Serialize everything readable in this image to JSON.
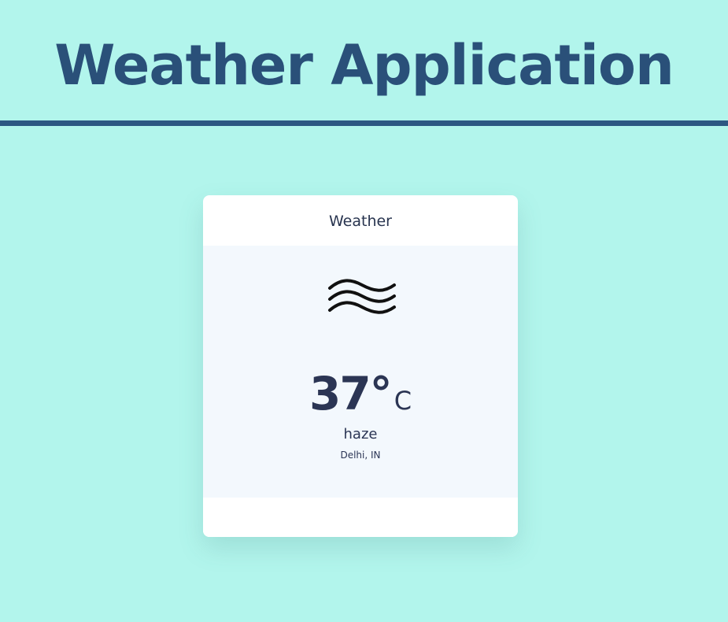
{
  "app": {
    "title": "Weather Application"
  },
  "card": {
    "header": "Weather",
    "icon": "haze-wind-icon",
    "temperature": "37°",
    "unit": "C",
    "condition": "haze",
    "location": "Delhi, IN"
  },
  "colors": {
    "background": "#b2f5ec",
    "title": "#2a5079",
    "divider": "#2c5782",
    "card": "#ffffff",
    "card_body": "#f3f8fd",
    "text": "#2b3554"
  }
}
